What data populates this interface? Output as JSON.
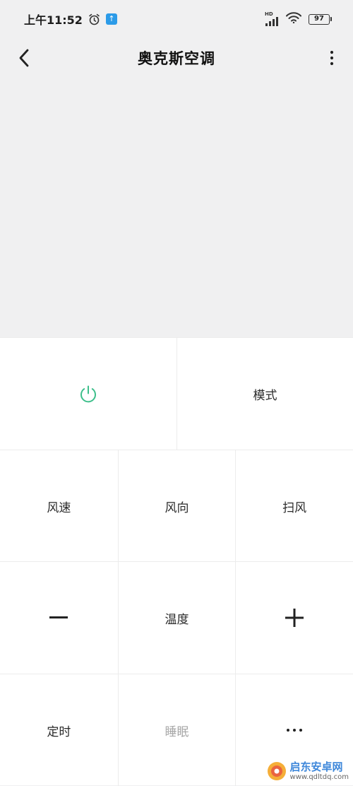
{
  "status_bar": {
    "time": "上午11:52",
    "notification_glyph": "↑",
    "battery_level": "97",
    "network_badge": "HD"
  },
  "header": {
    "title": "奥克斯空调",
    "back_icon": "chevron-left-icon",
    "more_icon": "more-vertical-icon"
  },
  "controls": {
    "power_icon": "power-icon",
    "mode_label": "模式",
    "fan_speed_label": "风速",
    "fan_direction_label": "风向",
    "swing_label": "扫风",
    "temp_down_icon": "minus-icon",
    "temperature_label": "温度",
    "temp_up_icon": "plus-icon",
    "timer_label": "定时",
    "sleep_label": "睡眠",
    "more_icon": "more-horizontal-icon"
  },
  "watermark": {
    "name": "启东安卓网",
    "url": "www.qdltdq.com"
  },
  "colors": {
    "accent": "#3dbf8b",
    "background": "#f0f0f1",
    "panel": "#ffffff",
    "disabled_text": "#a7a7a7"
  }
}
